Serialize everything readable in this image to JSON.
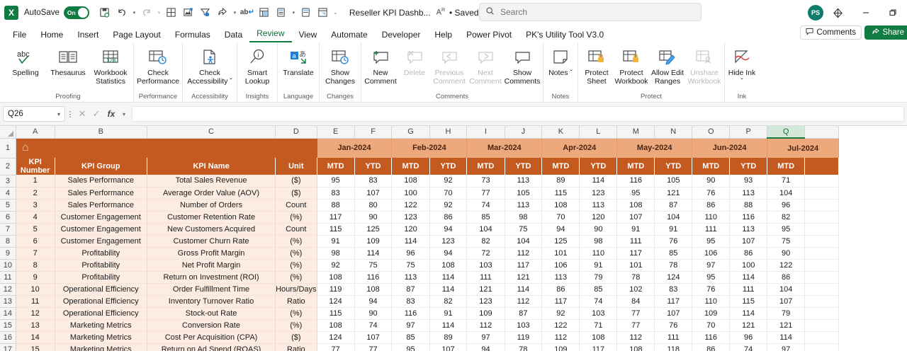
{
  "titlebar": {
    "app_icon": "excel-logo",
    "autosave_label": "AutoSave",
    "toggle_state": "On",
    "doc_title": "Reseller KPI Dashb...",
    "saved_status": "• Saved",
    "quick_access": [
      {
        "name": "save-icon",
        "glyph": "❐"
      },
      {
        "name": "undo-icon",
        "glyph": "↶"
      },
      {
        "name": "redo-icon",
        "glyph": "↷"
      },
      {
        "name": "table-icon",
        "glyph": "▦"
      },
      {
        "name": "image-export-icon",
        "glyph": "⛰"
      },
      {
        "name": "filter-icon",
        "glyph": "∇"
      },
      {
        "name": "share-arrow-icon",
        "glyph": "➦"
      },
      {
        "name": "spelling-icon",
        "glyph": "ab"
      },
      {
        "name": "pivot-table-icon",
        "glyph": "⌸"
      },
      {
        "name": "calculator-icon",
        "glyph": "⊞"
      },
      {
        "name": "calculator2-icon",
        "glyph": "▤"
      },
      {
        "name": "report-icon",
        "glyph": "▧"
      }
    ],
    "search": {
      "placeholder": "Search",
      "icon": "search-icon"
    },
    "avatar_initials": "PS",
    "diamond_icon": "diamond-icon",
    "minimize_icon": "minimize-icon",
    "restore_icon": "restore-icon"
  },
  "tabs": [
    {
      "label": "File",
      "active": false
    },
    {
      "label": "Home",
      "active": false
    },
    {
      "label": "Insert",
      "active": false
    },
    {
      "label": "Page Layout",
      "active": false
    },
    {
      "label": "Formulas",
      "active": false
    },
    {
      "label": "Data",
      "active": false
    },
    {
      "label": "Review",
      "active": true
    },
    {
      "label": "View",
      "active": false
    },
    {
      "label": "Automate",
      "active": false
    },
    {
      "label": "Developer",
      "active": false
    },
    {
      "label": "Help",
      "active": false
    },
    {
      "label": "Power Pivot",
      "active": false
    },
    {
      "label": "PK's Utility Tool V3.0",
      "active": false
    }
  ],
  "header_actions": {
    "comments_label": "Comments",
    "comments_icon": "comment-icon",
    "share_label": "Share",
    "share_icon": "share-icon"
  },
  "ribbon": {
    "groups": [
      {
        "label": "Proofing",
        "buttons": [
          {
            "caption": "Spelling",
            "icon": "spelling-check-icon",
            "disabled": false
          },
          {
            "caption": "Thesaurus",
            "icon": "thesaurus-book-icon",
            "disabled": false
          },
          {
            "caption": "Workbook Statistics",
            "icon": "workbook-statistics-icon",
            "disabled": false
          }
        ]
      },
      {
        "label": "Performance",
        "buttons": [
          {
            "caption": "Check Performance",
            "icon": "check-performance-icon",
            "disabled": false
          }
        ]
      },
      {
        "label": "Accessibility",
        "buttons": [
          {
            "caption": "Check Accessibility ˇ",
            "icon": "check-accessibility-icon",
            "disabled": false
          }
        ]
      },
      {
        "label": "Insights",
        "buttons": [
          {
            "caption": "Smart Lookup",
            "icon": "smart-lookup-icon",
            "disabled": false
          }
        ]
      },
      {
        "label": "Language",
        "buttons": [
          {
            "caption": "Translate",
            "icon": "translate-icon",
            "disabled": false
          }
        ]
      },
      {
        "label": "Changes",
        "buttons": [
          {
            "caption": "Show Changes",
            "icon": "show-changes-icon",
            "disabled": false
          }
        ]
      },
      {
        "label": "Comments",
        "buttons": [
          {
            "caption": "New Comment",
            "icon": "new-comment-icon",
            "disabled": false
          },
          {
            "caption": "Delete",
            "icon": "delete-comment-icon",
            "disabled": true
          },
          {
            "caption": "Previous Comment",
            "icon": "previous-comment-icon",
            "disabled": true
          },
          {
            "caption": "Next Comment",
            "icon": "next-comment-icon",
            "disabled": true
          },
          {
            "caption": "Show Comments",
            "icon": "show-comments-icon",
            "disabled": false
          }
        ]
      },
      {
        "label": "Notes",
        "buttons": [
          {
            "caption": "Notes ˇ",
            "icon": "notes-icon",
            "disabled": false
          }
        ]
      },
      {
        "label": "Protect",
        "buttons": [
          {
            "caption": "Protect Sheet",
            "icon": "protect-sheet-icon",
            "disabled": false
          },
          {
            "caption": "Protect Workbook",
            "icon": "protect-workbook-icon",
            "disabled": false
          },
          {
            "caption": "Allow Edit Ranges",
            "icon": "allow-edit-ranges-icon",
            "disabled": false
          },
          {
            "caption": "Unshare Workbook",
            "icon": "unshare-workbook-icon",
            "disabled": true
          }
        ]
      },
      {
        "label": "Ink",
        "buttons": [
          {
            "caption": "Hide Ink ˇ",
            "icon": "hide-ink-icon",
            "disabled": false
          }
        ]
      }
    ]
  },
  "formula_bar": {
    "name_box_value": "Q26",
    "cancel_icon": "cancel-icon",
    "confirm_icon": "confirm-icon",
    "fx_icon": "fx-icon",
    "formula_value": ""
  },
  "sheet": {
    "selected_column": "Q",
    "column_letters": [
      "A",
      "B",
      "C",
      "D",
      "E",
      "F",
      "G",
      "H",
      "I",
      "J",
      "K",
      "L",
      "M",
      "N",
      "O",
      "P",
      "Q"
    ],
    "row_numbers": [
      "1",
      "2",
      "3",
      "4",
      "5",
      "6",
      "7",
      "8",
      "9",
      "10",
      "11",
      "12",
      "13",
      "14",
      "15",
      "16",
      "17"
    ],
    "banner_icon": "home-icon",
    "months": [
      "Jan-2024",
      "Feb-2024",
      "Mar-2024",
      "Apr-2024",
      "May-2024",
      "Jun-2024",
      "Jul-2024"
    ],
    "sub_headers": [
      "MTD",
      "YTD"
    ],
    "left_headers": [
      "KPI Number",
      "KPI Group",
      "KPI Name",
      "Unit"
    ],
    "colors": {
      "header_orange": "#c55a21",
      "month_orange": "#eda97c",
      "row_peach": "#fcece1",
      "accent_green": "#107c41"
    },
    "rows": [
      {
        "num": "1",
        "group": "Sales Performance",
        "name": "Total Sales Revenue",
        "unit": "($)",
        "values": [
          95,
          83,
          108,
          92,
          73,
          113,
          89,
          114,
          116,
          105,
          90,
          93,
          71
        ]
      },
      {
        "num": "2",
        "group": "Sales Performance",
        "name": "Average Order Value (AOV)",
        "unit": "($)",
        "values": [
          83,
          107,
          100,
          70,
          77,
          105,
          115,
          123,
          95,
          121,
          76,
          113,
          104
        ]
      },
      {
        "num": "3",
        "group": "Sales Performance",
        "name": "Number of Orders",
        "unit": "Count",
        "values": [
          88,
          80,
          122,
          92,
          74,
          113,
          108,
          113,
          108,
          87,
          86,
          88,
          96
        ]
      },
      {
        "num": "4",
        "group": "Customer Engagement",
        "name": "Customer Retention Rate",
        "unit": "(%)",
        "values": [
          117,
          90,
          123,
          86,
          85,
          98,
          70,
          120,
          107,
          104,
          110,
          116,
          82
        ]
      },
      {
        "num": "5",
        "group": "Customer Engagement",
        "name": "New Customers Acquired",
        "unit": "Count",
        "values": [
          115,
          125,
          120,
          94,
          104,
          75,
          94,
          90,
          91,
          91,
          111,
          113,
          95
        ]
      },
      {
        "num": "6",
        "group": "Customer Engagement",
        "name": "Customer Churn Rate",
        "unit": "(%)",
        "values": [
          91,
          109,
          114,
          123,
          82,
          104,
          125,
          98,
          111,
          76,
          95,
          107,
          75
        ]
      },
      {
        "num": "7",
        "group": "Profitability",
        "name": "Gross Profit Margin",
        "unit": "(%)",
        "values": [
          98,
          114,
          96,
          94,
          72,
          112,
          101,
          110,
          117,
          85,
          106,
          86,
          90
        ]
      },
      {
        "num": "8",
        "group": "Profitability",
        "name": "Net Profit Margin",
        "unit": "(%)",
        "values": [
          92,
          75,
          75,
          108,
          103,
          117,
          106,
          91,
          101,
          78,
          97,
          100,
          122
        ]
      },
      {
        "num": "9",
        "group": "Profitability",
        "name": "Return on Investment (ROI)",
        "unit": "(%)",
        "values": [
          108,
          116,
          113,
          114,
          111,
          121,
          113,
          79,
          78,
          124,
          95,
          114,
          86
        ]
      },
      {
        "num": "10",
        "group": "Operational Efficiency",
        "name": "Order Fulfillment Time",
        "unit": "Hours/Days",
        "values": [
          119,
          108,
          87,
          114,
          121,
          114,
          86,
          85,
          102,
          83,
          76,
          111,
          104
        ]
      },
      {
        "num": "11",
        "group": "Operational Efficiency",
        "name": "Inventory Turnover Ratio",
        "unit": "Ratio",
        "values": [
          124,
          94,
          83,
          82,
          123,
          112,
          117,
          74,
          84,
          117,
          110,
          115,
          107
        ]
      },
      {
        "num": "12",
        "group": "Operational Efficiency",
        "name": "Stock-out Rate",
        "unit": "(%)",
        "values": [
          115,
          90,
          116,
          91,
          109,
          87,
          92,
          103,
          77,
          107,
          109,
          114,
          79
        ]
      },
      {
        "num": "13",
        "group": "Marketing Metrics",
        "name": "Conversion Rate",
        "unit": "(%)",
        "values": [
          108,
          74,
          97,
          114,
          112,
          103,
          122,
          71,
          77,
          76,
          70,
          121,
          121
        ]
      },
      {
        "num": "14",
        "group": "Marketing Metrics",
        "name": "Cost Per Acquisition (CPA)",
        "unit": "($)",
        "values": [
          124,
          107,
          85,
          89,
          97,
          119,
          112,
          108,
          112,
          111,
          116,
          96,
          114
        ]
      },
      {
        "num": "15",
        "group": "Marketing Metrics",
        "name": "Return on Ad Spend (ROAS)",
        "unit": "Ratio",
        "values": [
          77,
          77,
          95,
          107,
          94,
          78,
          109,
          117,
          108,
          118,
          86,
          74,
          97
        ]
      }
    ]
  }
}
